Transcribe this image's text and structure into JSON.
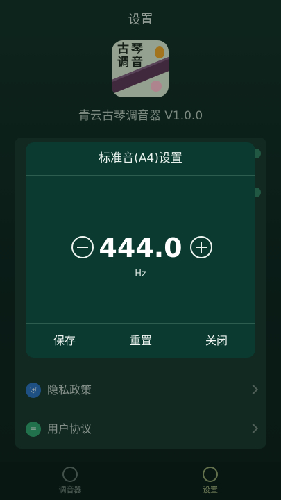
{
  "header": {
    "title": "设置"
  },
  "app": {
    "icon_text": "古琴\n调音",
    "name": "青云古琴调音器 V1.0.0"
  },
  "settings_list": [
    {
      "label": "隐私政策",
      "icon": "shield-icon",
      "icon_color": "#2b6fb8"
    },
    {
      "label": "用户协议",
      "icon": "document-icon",
      "icon_color": "#2f9e6a"
    }
  ],
  "tabbar": {
    "tabs": [
      {
        "label": "调音器",
        "icon": "tuner-icon",
        "active": false
      },
      {
        "label": "设置",
        "icon": "gear-icon",
        "active": true
      }
    ]
  },
  "modal": {
    "title": "标准音(A4)设置",
    "value": "444.0",
    "unit": "Hz",
    "decrement_icon": "minus-circle-icon",
    "increment_icon": "plus-circle-icon",
    "actions": {
      "save": "保存",
      "reset": "重置",
      "close": "关闭"
    }
  },
  "colors": {
    "background": "#112a22",
    "modal": "#0a3a30",
    "accent": "#9db07c"
  }
}
